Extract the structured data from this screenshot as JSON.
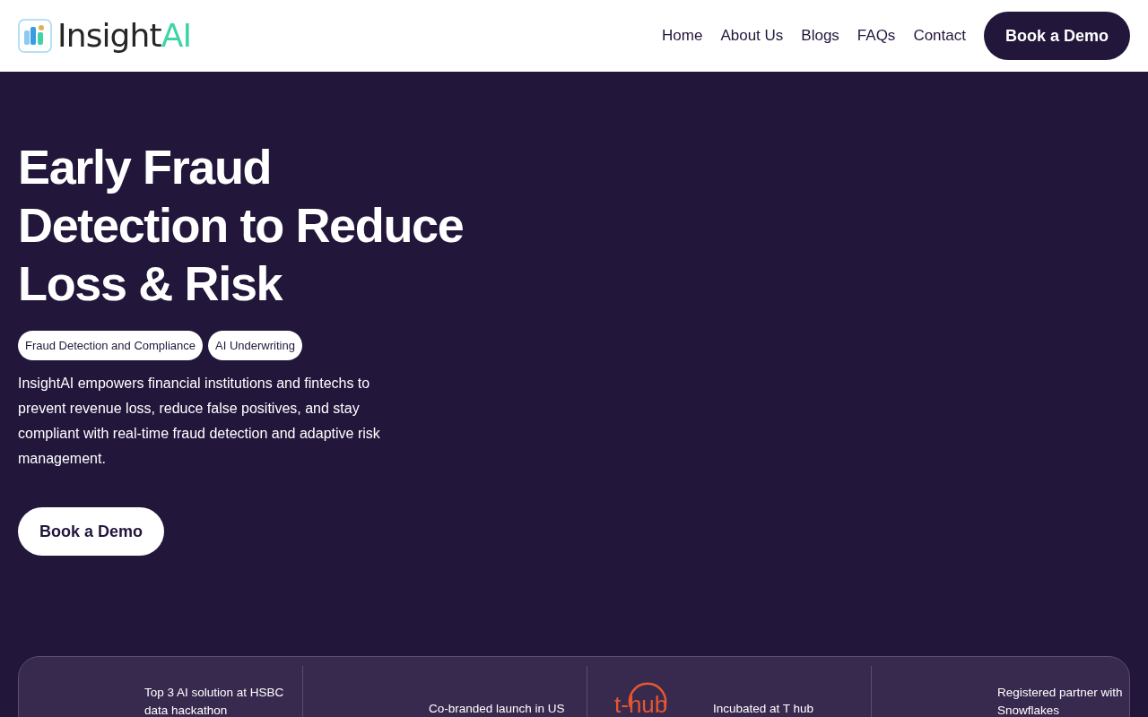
{
  "brand": {
    "name": "Insight",
    "accent": "AI"
  },
  "nav": {
    "links": [
      "Home",
      "About Us",
      "Blogs",
      "FAQs",
      "Contact"
    ],
    "cta": "Book a Demo"
  },
  "hero": {
    "title": "Early Fraud Detection to Reduce Loss & Risk",
    "tags": [
      "Fraud Detection and Compliance",
      "AI Underwriting"
    ],
    "description": "InsightAI empowers financial institutions and fintechs to prevent revenue loss, reduce false positives, and stay compliant with real-time fraud detection and adaptive risk management.",
    "cta": "Book a Demo"
  },
  "highlights": [
    {
      "kind": "blank",
      "text": "Top 3 AI solution at HSBC data hackathon"
    },
    {
      "kind": "blank",
      "text": "Co-branded launch in US"
    },
    {
      "kind": "thub",
      "logo_text": "t-hub",
      "text": "Incubated at T hub"
    },
    {
      "kind": "blank",
      "text": "Registered partner with Snowflakes"
    }
  ]
}
